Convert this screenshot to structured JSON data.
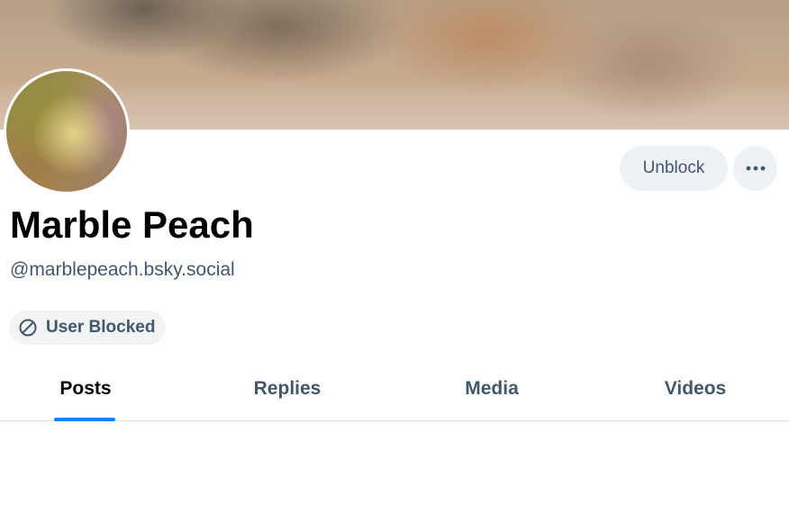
{
  "profile": {
    "display_name": "Marble Peach",
    "handle": "@marblepeach.bsky.social",
    "banner_icon": "blurred-banner-image",
    "avatar_icon": "blurred-avatar-image"
  },
  "actions": {
    "unblock_label": "Unblock",
    "more_icon": "ellipsis-horizontal-icon"
  },
  "status": {
    "blocked_label": "User Blocked",
    "blocked_icon": "block-icon"
  },
  "tabs": [
    {
      "label": "Posts",
      "active": true
    },
    {
      "label": "Replies",
      "active": false
    },
    {
      "label": "Media",
      "active": false
    },
    {
      "label": "Videos",
      "active": false
    }
  ],
  "colors": {
    "accent": "#1083fe",
    "secondary_text": "#42576c",
    "button_bg": "#eef1f6"
  }
}
